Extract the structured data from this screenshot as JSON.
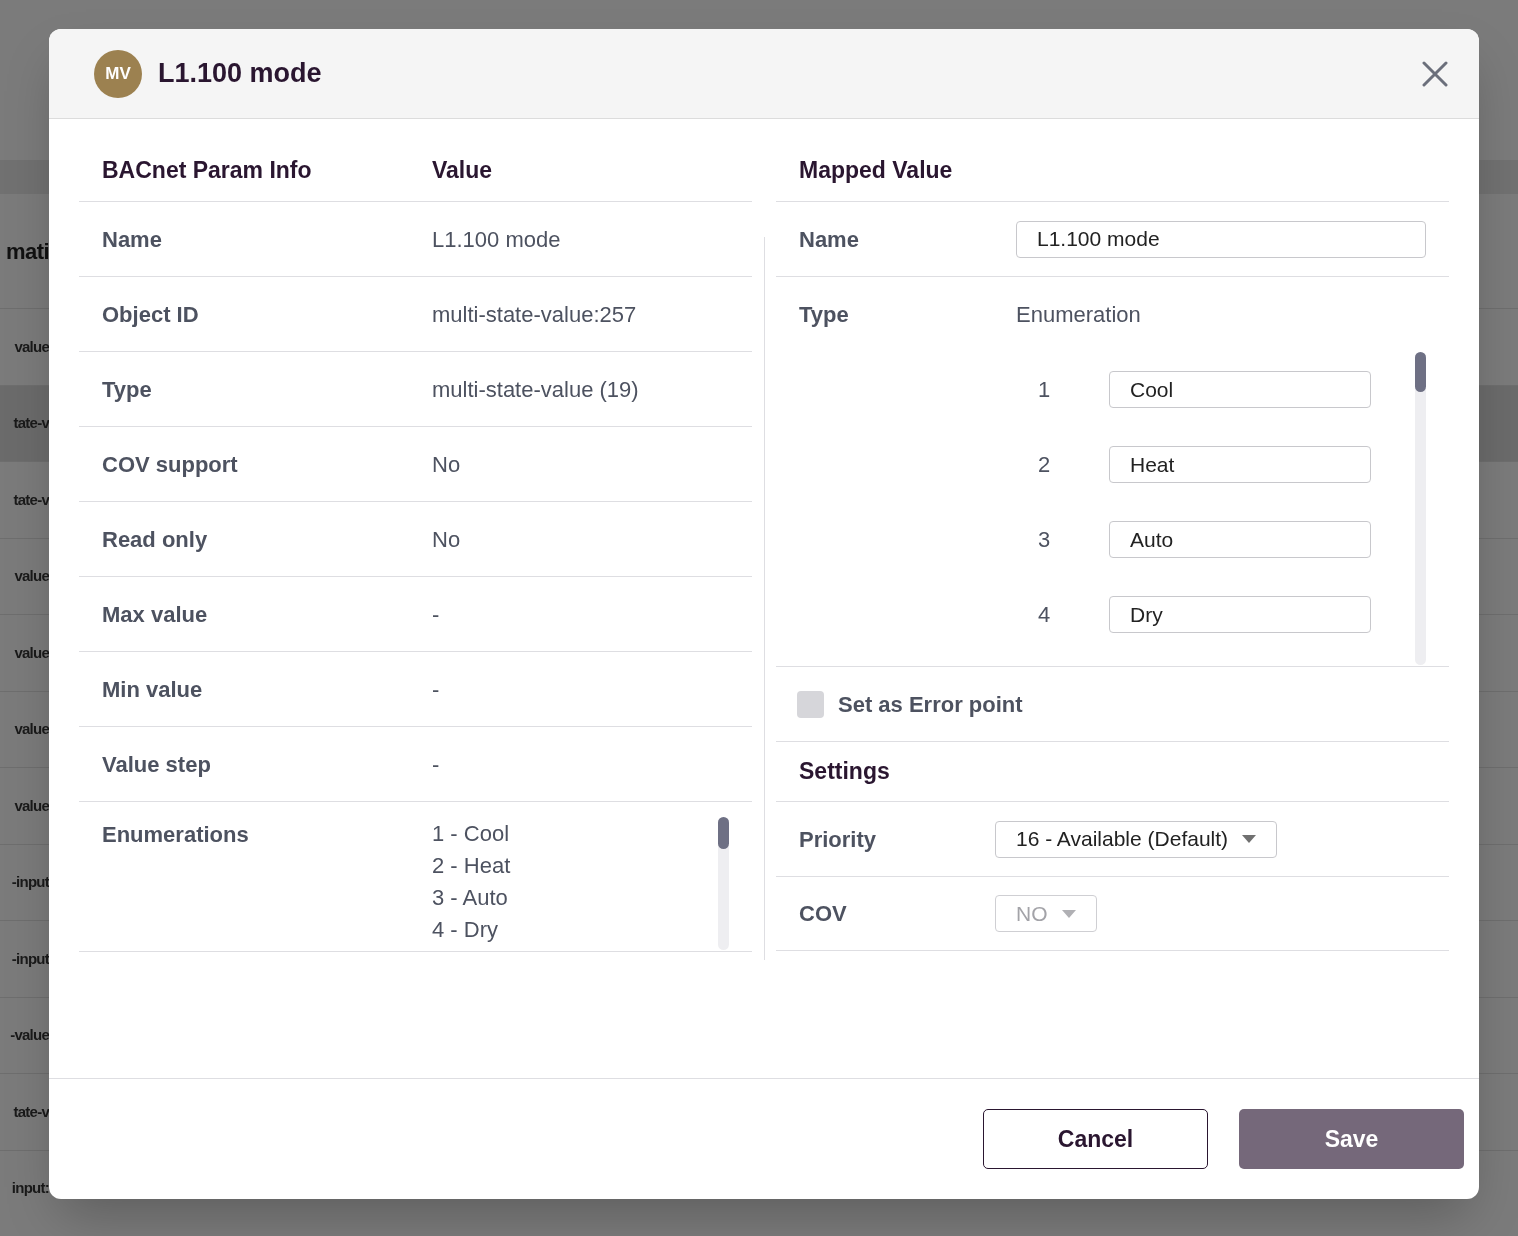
{
  "background": {
    "heading": "mati",
    "rows": [
      {
        "text": "value",
        "selected": false
      },
      {
        "text": "tate-v",
        "selected": true
      },
      {
        "text": "tate-v",
        "selected": false
      },
      {
        "text": "value",
        "selected": false
      },
      {
        "text": "value",
        "selected": false
      },
      {
        "text": "value",
        "selected": false
      },
      {
        "text": "value",
        "selected": false
      },
      {
        "text": "-input",
        "selected": false
      },
      {
        "text": "-input",
        "selected": false
      },
      {
        "text": "-value",
        "selected": false
      },
      {
        "text": "tate-v",
        "selected": false
      },
      {
        "text": "input:",
        "selected": false
      }
    ]
  },
  "dialog": {
    "avatar": "MV",
    "title": "L1.100 mode",
    "info_table": {
      "columns": [
        "BACnet Param Info",
        "Value"
      ],
      "rows": [
        {
          "label": "Name",
          "value": "L1.100 mode"
        },
        {
          "label": "Object ID",
          "value": "multi-state-value:257"
        },
        {
          "label": "Type",
          "value": "multi-state-value (19)"
        },
        {
          "label": "COV support",
          "value": "No"
        },
        {
          "label": "Read only",
          "value": "No"
        },
        {
          "label": "Max value",
          "value": "-"
        },
        {
          "label": "Min value",
          "value": "-"
        },
        {
          "label": "Value step",
          "value": "-"
        }
      ],
      "enumerations": {
        "label": "Enumerations",
        "items": [
          "1 - Cool",
          "2 - Heat",
          "3 - Auto",
          "4 - Dry"
        ]
      }
    },
    "mapped": {
      "heading": "Mapped Value",
      "name": {
        "label": "Name",
        "value": "L1.100 mode"
      },
      "type": {
        "label": "Type",
        "value": "Enumeration"
      },
      "enum_fields": [
        {
          "number": "1",
          "value": "Cool"
        },
        {
          "number": "2",
          "value": "Heat"
        },
        {
          "number": "3",
          "value": "Auto"
        },
        {
          "number": "4",
          "value": "Dry"
        }
      ],
      "error_point": {
        "label": "Set as Error point",
        "checked": false
      },
      "settings": {
        "heading": "Settings",
        "priority": {
          "label": "Priority",
          "value": "16 - Available (Default)",
          "disabled": false
        },
        "cov": {
          "label": "COV",
          "value": "NO",
          "disabled": true
        }
      }
    },
    "buttons": [
      {
        "label": "Cancel",
        "kind": "secondary"
      },
      {
        "label": "Save",
        "kind": "primary"
      }
    ]
  }
}
